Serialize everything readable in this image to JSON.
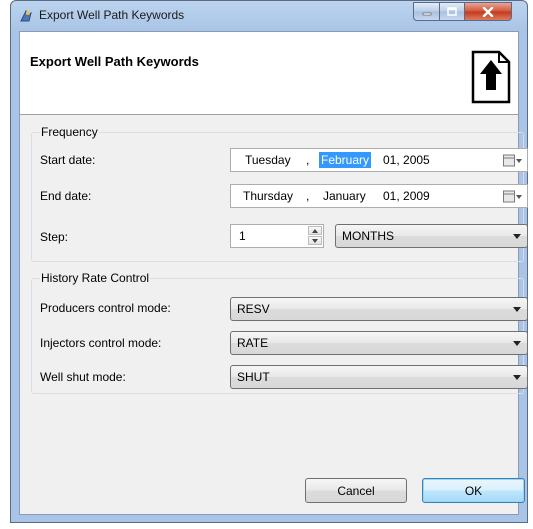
{
  "window": {
    "title": "Export Well Path Keywords",
    "controls": {
      "minimize_icon": "minimize-icon",
      "maximize_icon": "maximize-icon",
      "close_icon": "close-icon"
    }
  },
  "header": {
    "title": "Export Well Path Keywords",
    "icon": "export-upload-icon"
  },
  "frequency": {
    "group_title": "Frequency",
    "start_date": {
      "label": "Start date:",
      "weekday": "Tuesday",
      "separator": ",",
      "month": "February",
      "day_year": "01, 2005"
    },
    "end_date": {
      "label": "End date:",
      "weekday": "Thursday",
      "separator": ",",
      "month": "January",
      "day_year": "01, 2009"
    },
    "step": {
      "label": "Step:",
      "value": "1",
      "unit": "MONTHS"
    }
  },
  "history": {
    "group_title": "History Rate Control",
    "producers": {
      "label": "Producers control mode:",
      "value": "RESV"
    },
    "injectors": {
      "label": "Injectors control mode:",
      "value": "RATE"
    },
    "shut": {
      "label": "Well shut mode:",
      "value": "SHUT"
    }
  },
  "buttons": {
    "cancel": "Cancel",
    "ok": "OK"
  },
  "colors": {
    "selection": "#3399ff",
    "ok_border": "#3c7fb1",
    "close_button": "#c2391c"
  }
}
